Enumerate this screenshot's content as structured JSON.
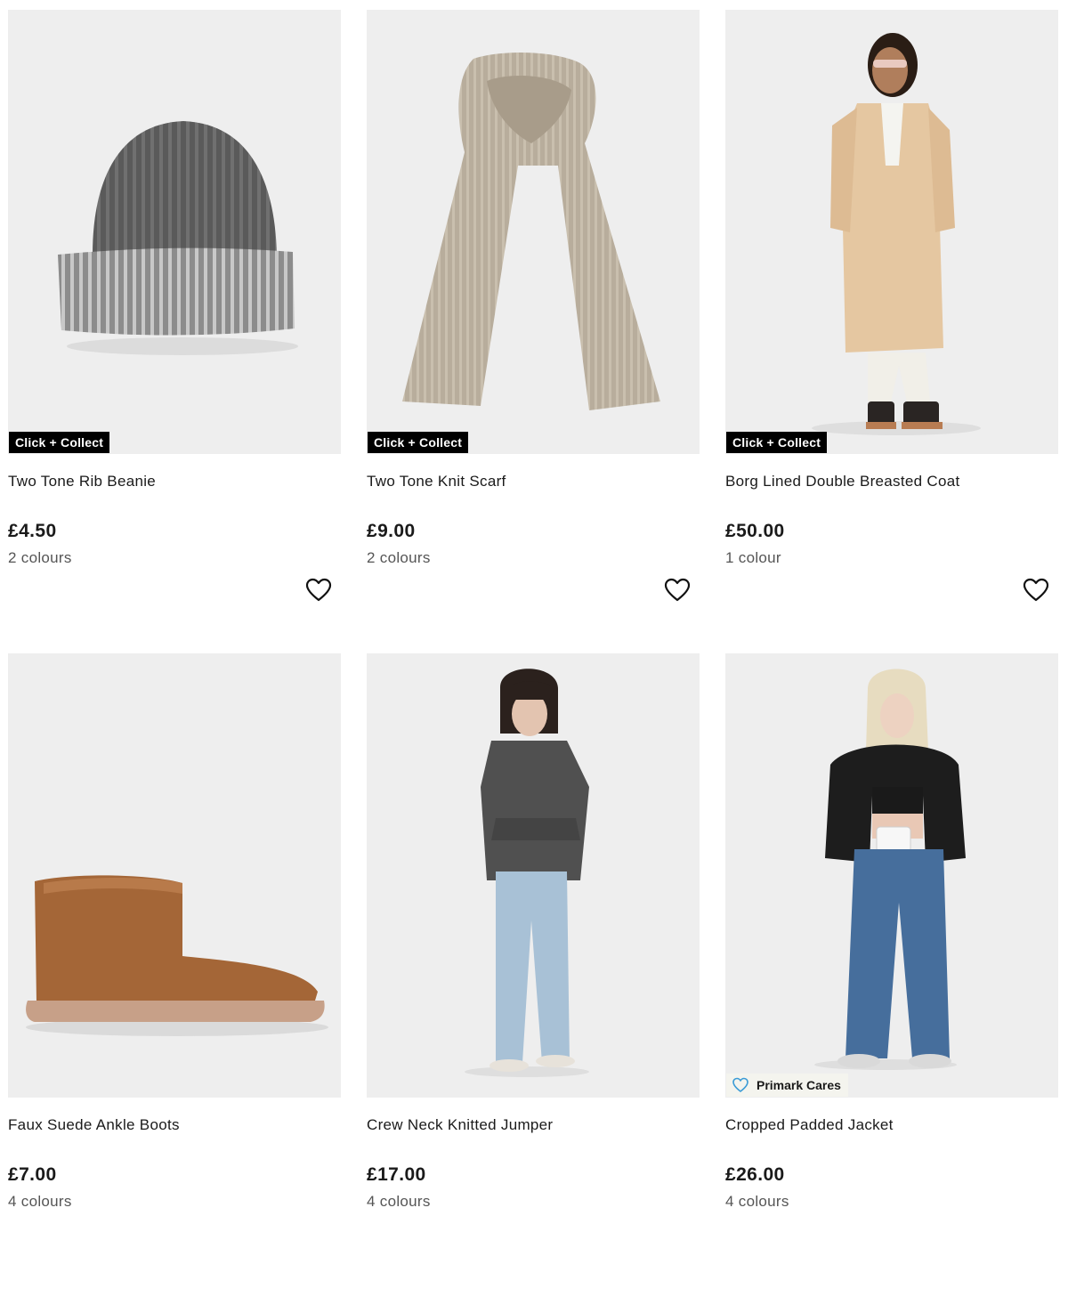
{
  "products": [
    {
      "name": "Two Tone Rib Beanie",
      "price": "£4.50",
      "colours": "2 colours",
      "badge": "Click + Collect",
      "image_icon": "beanie-image"
    },
    {
      "name": "Two Tone Knit Scarf",
      "price": "£9.00",
      "colours": "2 colours",
      "badge": "Click + Collect",
      "image_icon": "scarf-image"
    },
    {
      "name": "Borg Lined Double Breasted Coat",
      "price": "£50.00",
      "colours": "1 colour",
      "badge": "Click + Collect",
      "image_icon": "coat-model-image"
    },
    {
      "name": "Faux Suede Ankle Boots",
      "price": "£7.00",
      "colours": "4 colours",
      "image_icon": "boot-image"
    },
    {
      "name": "Crew Neck Knitted Jumper",
      "price": "£17.00",
      "colours": "4 colours",
      "image_icon": "jumper-model-image"
    },
    {
      "name": "Cropped Padded Jacket",
      "price": "£26.00",
      "colours": "4 colours",
      "badge": "Primark Cares",
      "image_icon": "jacket-model-image"
    }
  ],
  "wishlist_icon": "heart-outline-icon",
  "colors": {
    "image_background": "#eeeeee",
    "badge_background": "#000000",
    "badge_text": "#ffffff",
    "cares_badge_background": "#f4f4ee",
    "cares_heart": "#3a9bd6",
    "price_text": "#1a1a1a",
    "colours_text": "#555555"
  }
}
